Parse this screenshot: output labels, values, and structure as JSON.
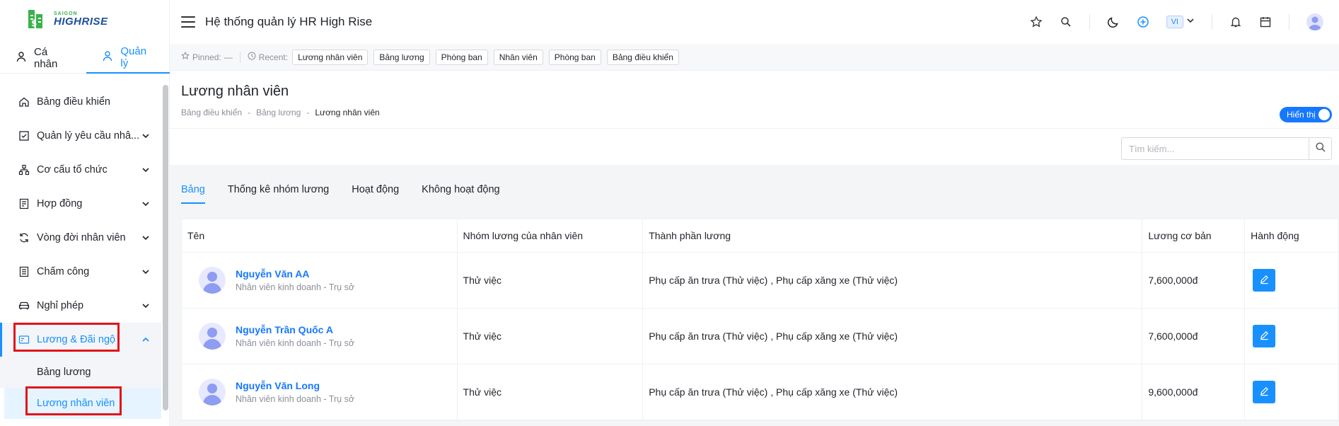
{
  "brand": {
    "small": "SAIGON",
    "big": "HIGHRISE"
  },
  "mode_tabs": [
    {
      "label": "Cá nhân"
    },
    {
      "label": "Quản lý"
    }
  ],
  "menu": [
    {
      "label": "Bảng điều khiển"
    },
    {
      "label": "Quản lý yêu cầu nhâ..."
    },
    {
      "label": "Cơ cấu tổ chức"
    },
    {
      "label": "Hợp đồng"
    },
    {
      "label": "Vòng đời nhân viên"
    },
    {
      "label": "Chấm công"
    },
    {
      "label": "Nghỉ phép"
    },
    {
      "label": "Lương & Đãi ngộ"
    }
  ],
  "submenu": [
    {
      "label": "Bảng lương"
    },
    {
      "label": "Lương nhân viên"
    }
  ],
  "header": {
    "title": "Hệ thống quản lý HR High Rise",
    "lang": "VI"
  },
  "pinbar": {
    "pinned_label": "Pinned:",
    "pinned_value": "—",
    "recent_label": "Recent:",
    "recent": [
      "Lương nhân viên",
      "Bảng lương",
      "Phòng ban",
      "Nhân viên",
      "Phòng ban",
      "Bảng điều khiển"
    ]
  },
  "page": {
    "title": "Lương nhân viên",
    "breadcrumb": [
      "Bảng điều khiển",
      "Bảng lương",
      "Lương nhân viên"
    ],
    "breadcrumb_sep": "-",
    "toggle_label": "Hiển thị"
  },
  "search": {
    "placeholder": "Tìm kiếm..."
  },
  "tabs": [
    {
      "label": "Bảng"
    },
    {
      "label": "Thống kê nhóm lương"
    },
    {
      "label": "Hoạt động"
    },
    {
      "label": "Không hoạt động"
    }
  ],
  "table": {
    "headers": [
      "Tên",
      "Nhóm lương của nhân viên",
      "Thành phần lương",
      "Lương cơ bản",
      "Hành động"
    ],
    "rows": [
      {
        "name": "Nguyễn Văn AA",
        "sub": "Nhân viên kinh doanh - Trụ sở",
        "group": "Thử việc",
        "components": "Phụ cấp ăn trưa (Thử việc) , Phụ cấp xăng xe (Thử việc)",
        "base": "7,600,000đ"
      },
      {
        "name": "Nguyễn Trần Quốc A",
        "sub": "Nhân viên kinh doanh - Trụ sở",
        "group": "Thử việc",
        "components": "Phụ cấp ăn trưa (Thử việc) , Phụ cấp xăng xe (Thử việc)",
        "base": "7,600,000đ"
      },
      {
        "name": "Nguyễn Văn Long",
        "sub": "Nhân viên kinh doanh - Trụ sở",
        "group": "Thử việc",
        "components": "Phụ cấp ăn trưa (Thử việc) , Phụ cấp xăng xe (Thử việc)",
        "base": "9,600,000đ"
      }
    ]
  },
  "colors": {
    "accent": "#1890ff",
    "highlight": "#e3131a",
    "brand_green": "#38b24a",
    "brand_blue": "#1d4e9c"
  },
  "icons": [
    "building-logo-icon",
    "user-icon",
    "home-icon",
    "checkbox-icon",
    "org-chart-icon",
    "contract-icon",
    "cycle-icon",
    "attendance-icon",
    "car-icon",
    "payroll-icon",
    "chevron-down-icon",
    "chevron-up-icon",
    "star-icon",
    "search-icon",
    "moon-icon",
    "plus-circle-icon",
    "bell-icon",
    "calendar-icon",
    "clock-icon",
    "edit-icon"
  ]
}
